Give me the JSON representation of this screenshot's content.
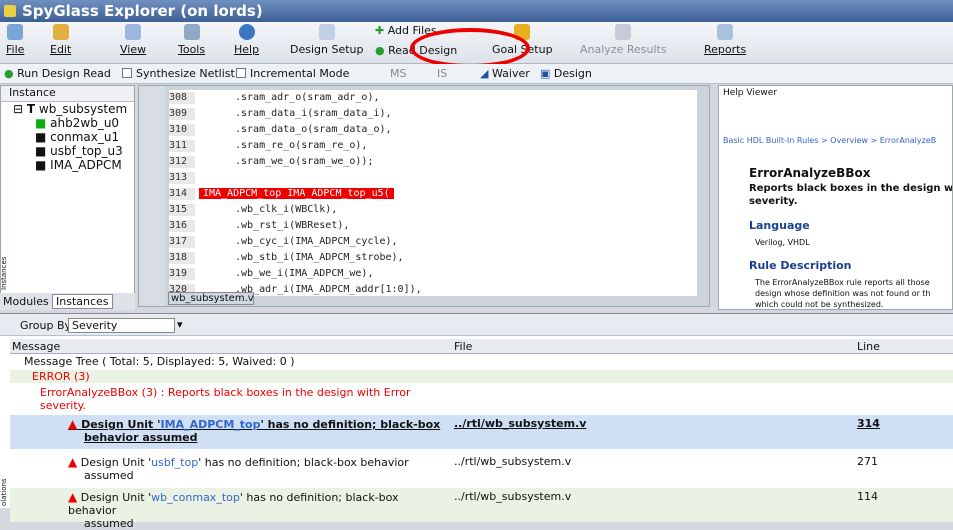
{
  "app": {
    "title": "SpyGlass Explorer (on lords)"
  },
  "toolbar": {
    "file": "File",
    "edit": "Edit",
    "view": "View",
    "tools": "Tools",
    "help": "Help",
    "design_setup": "Design Setup",
    "add_files": "Add Files",
    "read_design": "Read Design",
    "goal_setup": "Goal Setup",
    "analyze_results": "Analyze Results",
    "reports": "Reports"
  },
  "toolbar2": {
    "run_design_read": "Run Design Read",
    "synthesize_netlist": "Synthesize Netlist",
    "incremental_mode": "Incremental Mode",
    "ms": "MS",
    "is": "IS",
    "waiver": "Waiver",
    "design": "Design"
  },
  "left": {
    "header": "Instance",
    "root": "wb_subsystem",
    "items": [
      "ahb2wb_u0",
      "conmax_u1",
      "usbf_top_u3",
      "IMA_ADPCM"
    ],
    "tab_modules": "Modules",
    "tab_instances": "Instances",
    "side_label": "Instances"
  },
  "editor": {
    "lines": [
      "308",
      "309",
      "310",
      "311",
      "312",
      "313",
      "314",
      "315",
      "316",
      "317",
      "318",
      "319",
      "320"
    ],
    "code": [
      ".sram_adr_o(sram_adr_o),",
      ".sram_data_i(sram_data_i),",
      ".sram_data_o(sram_data_o),",
      ".sram_re_o(sram_re_o),",
      ".sram_we_o(sram_we_o));",
      "",
      "IMA_ADPCM_top IMA_ADPCM_top_u5(",
      ".wb_clk_i(WBClk),",
      ".wb_rst_i(WBReset),",
      ".wb_cyc_i(IMA_ADPCM_cycle),",
      ".wb_stb_i(IMA_ADPCM_strobe),",
      ".wb_we_i(IMA_ADPCM_we),",
      ".wb_adr_i(IMA_ADPCM_addr[1:0]),"
    ],
    "tab": "wb_subsystem.v"
  },
  "help": {
    "title": "Help Viewer",
    "breadcrumb": "Basic HDL Built-In Rules > Overview > ErrorAnalyzeB",
    "rule": "ErrorAnalyzeBBox",
    "summary1": "Reports black boxes in the design w",
    "summary2": "severity.",
    "lang_title": "Language",
    "lang": "Verilog, VHDL",
    "desc_title": "Rule Description",
    "desc1": "The ErrorAnalyzeBBox rule reports all those",
    "desc2": "design whose definition was not found or th",
    "desc3": "which could not be synthesized."
  },
  "lower": {
    "group_by": "Group By:",
    "group_value": "Severity",
    "col_message": "Message",
    "col_file": "File",
    "col_line": "Line",
    "tree": "Message Tree ( Total: 5, Displayed: 5, Waived: 0 )",
    "error": "ERROR (3)",
    "rule1": "ErrorAnalyzeBBox (3) : Reports black boxes in the design with Error",
    "rule2": "severity.",
    "side_label": "olations",
    "rows": [
      {
        "pre": "Design Unit '",
        "unit": "IMA_ADPCM_top",
        "post": "' has no definition; black-box",
        "post2": "behavior assumed",
        "file": "../rtl/wb_subsystem.v",
        "line": "314"
      },
      {
        "pre": "Design Unit '",
        "unit": "usbf_top",
        "post": "' has no definition; black-box behavior",
        "post2": "assumed",
        "file": "../rtl/wb_subsystem.v",
        "line": "271"
      },
      {
        "pre": "Design Unit '",
        "unit": "wb_conmax_top",
        "post": "' has no definition; black-box behavior",
        "post2": "assumed",
        "file": "../rtl/wb_subsystem.v",
        "line": "114"
      }
    ]
  }
}
